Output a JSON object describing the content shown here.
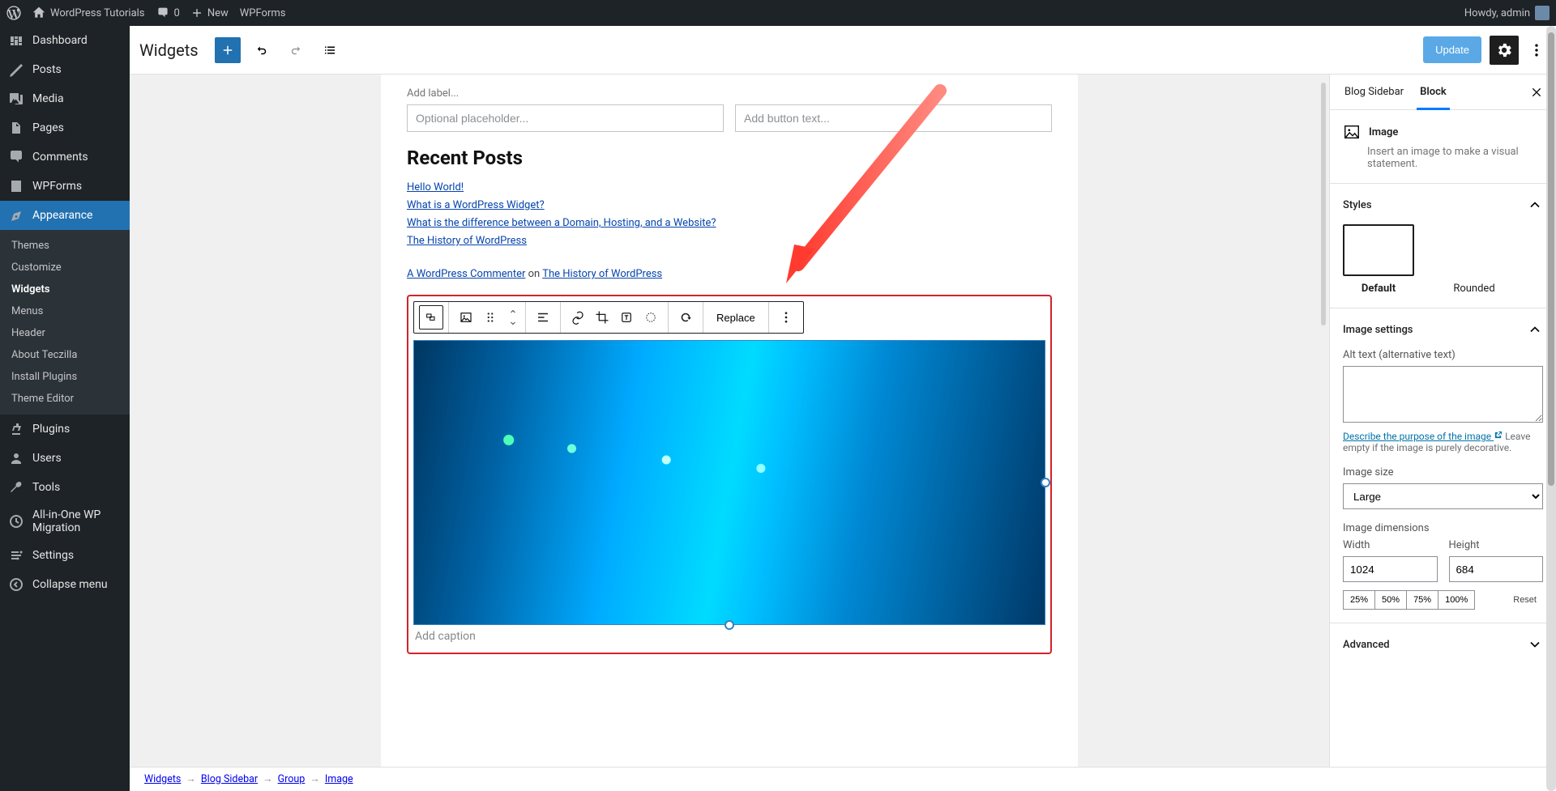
{
  "adminbar": {
    "site": "WordPress Tutorials",
    "comments": "0",
    "new": "New",
    "wpforms": "WPForms",
    "howdy": "Howdy, admin"
  },
  "adminmenu": {
    "dashboard": "Dashboard",
    "posts": "Posts",
    "media": "Media",
    "pages": "Pages",
    "comments": "Comments",
    "wpforms": "WPForms",
    "appearance": "Appearance",
    "sub": {
      "themes": "Themes",
      "customize": "Customize",
      "widgets": "Widgets",
      "menus": "Menus",
      "header": "Header",
      "about": "About Teczilla",
      "install": "Install Plugins",
      "editor": "Theme Editor"
    },
    "plugins": "Plugins",
    "users": "Users",
    "tools": "Tools",
    "aio": "All-in-One WP Migration",
    "settings": "Settings",
    "collapse": "Collapse menu"
  },
  "header": {
    "title": "Widgets",
    "update": "Update"
  },
  "canvas": {
    "add_label": "Add label...",
    "placeholder": "Optional placeholder...",
    "button_ph": "Add button text...",
    "recent_posts": "Recent Posts",
    "links": [
      "Hello World!",
      "What is a WordPress Widget?",
      "What is the difference between a Domain, Hosting, and a Website?",
      "The History of WordPress"
    ],
    "commenter": "A WordPress Commenter",
    "on": " on ",
    "commenter_post": "The History of WordPress",
    "replace": "Replace",
    "caption_ph": "Add caption"
  },
  "inspector": {
    "tab_area": "Blog Sidebar",
    "tab_block": "Block",
    "block_name": "Image",
    "block_desc": "Insert an image to make a visual statement.",
    "styles_title": "Styles",
    "style_default": "Default",
    "style_rounded": "Rounded",
    "settings_title": "Image settings",
    "alt_label": "Alt text (alternative text)",
    "alt_help_link": "Describe the purpose of the image",
    "alt_help_rest": " Leave empty if the image is purely decorative.",
    "size_label": "Image size",
    "size_value": "Large",
    "dim_label": "Image dimensions",
    "width_label": "Width",
    "height_label": "Height",
    "width_value": "1024",
    "height_value": "684",
    "pcts": [
      "25%",
      "50%",
      "75%",
      "100%"
    ],
    "reset": "Reset",
    "advanced": "Advanced"
  },
  "breadcrumb": [
    "Widgets",
    "Blog Sidebar",
    "Group",
    "Image"
  ]
}
